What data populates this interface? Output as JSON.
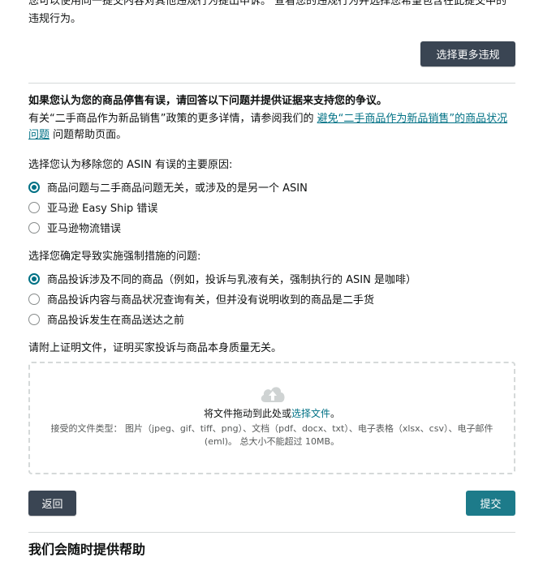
{
  "intro_text": "您可以使用同一提交内容对其他违规行为提出申诉。 查看您的违规行为并选择您希望包含在此提交中的违规行为。",
  "select_more_button": "选择更多违规",
  "dispute_heading": "如果您认为您的商品停售有误，请回答以下问题并提供证据来支持您的争议。",
  "info": {
    "prefix": "有关“二手商品作为新品销售”政策的更多详情，请参阅我们的 ",
    "link": "避免“二手商品作为新品销售”的商品状况问题",
    "suffix": " 问题帮助页面。"
  },
  "question1": {
    "label": "选择您认为移除您的 ASIN 有误的主要原因:",
    "options": [
      {
        "label": "商品问题与二手商品问题无关，或涉及的是另一个 ASIN",
        "selected": true
      },
      {
        "label": "亚马逊 Easy Ship 错误",
        "selected": false
      },
      {
        "label": "亚马逊物流错误",
        "selected": false
      }
    ]
  },
  "question2": {
    "label": "选择您确定导致实施强制措施的问题:",
    "options": [
      {
        "label": "商品投诉涉及不同的商品（例如，投诉与乳液有关，强制执行的 ASIN 是咖啡）",
        "selected": true
      },
      {
        "label": "商品投诉内容与商品状况查询有关，但并没有说明收到的商品是二手货",
        "selected": false
      },
      {
        "label": "商品投诉发生在商品送达之前",
        "selected": false
      }
    ]
  },
  "attach_label": "请附上证明文件，证明买家投诉与商品本身质量无关。",
  "dropzone": {
    "icon": "cloud-upload-icon",
    "text_prefix": "将文件拖动到此处或",
    "link": "选择文件",
    "text_suffix": "。",
    "accepted": "接受的文件类型： 图片（jpeg、gif、tiff、png）、文档（pdf、docx、txt）、电子表格（xlsx、csv）、电子邮件 (eml)。 总大小不能超过 10MB。"
  },
  "back_button": "返回",
  "submit_button": "提交",
  "help_title": "我们会随时提供帮助",
  "colors": {
    "accent": "#007185",
    "dark_button": "#3a4553",
    "submit": "#1d7b8a"
  }
}
